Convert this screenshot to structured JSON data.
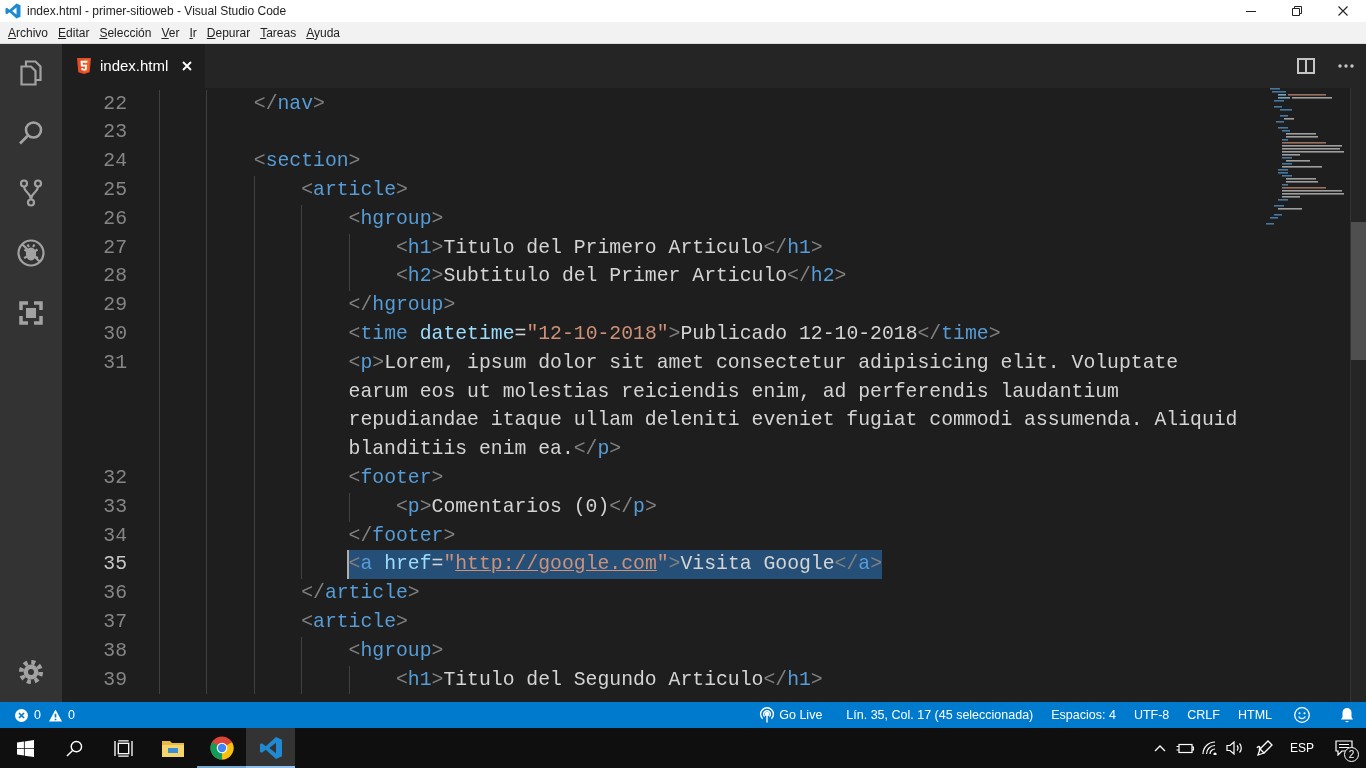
{
  "window": {
    "title": "index.html - primer-sitioweb - Visual Studio Code"
  },
  "menu": [
    "Archivo",
    "Editar",
    "Selección",
    "Ver",
    "Ir",
    "Depurar",
    "Tareas",
    "Ayuda"
  ],
  "activity_bar": [
    {
      "kind": "files",
      "selected": false
    },
    {
      "kind": "search",
      "selected": false
    },
    {
      "kind": "source_control",
      "selected": false
    },
    {
      "kind": "debug",
      "selected": false
    },
    {
      "kind": "extensions",
      "selected": false
    }
  ],
  "tabs": [
    {
      "label": "index.html",
      "selected": true
    }
  ],
  "editor": {
    "lines": [
      {
        "number": "22",
        "selected": false,
        "segments": [
          {
            "tokens": [
              {
                "kind": "punct",
                "text": "</"
              },
              {
                "kind": "tag",
                "text": "nav"
              },
              {
                "kind": "punct",
                "text": ">"
              }
            ]
          }
        ]
      },
      {
        "number": "23",
        "selected": false
      },
      {
        "number": "24",
        "selected": false,
        "segments": [
          {
            "tokens": [
              {
                "kind": "punct",
                "text": "<"
              },
              {
                "kind": "tag",
                "text": "section"
              },
              {
                "kind": "punct",
                "text": ">"
              }
            ]
          }
        ],
        "children": [
          {
            "number": "25",
            "selected": false,
            "segments": [
              {
                "tokens": [
                  {
                    "kind": "punct",
                    "text": "<"
                  },
                  {
                    "kind": "tag",
                    "text": "article"
                  },
                  {
                    "kind": "punct",
                    "text": ">"
                  }
                ]
              }
            ],
            "children": [
              {
                "number": "26",
                "selected": false,
                "segments": [
                  {
                    "tokens": [
                      {
                        "kind": "punct",
                        "text": "<"
                      },
                      {
                        "kind": "tag",
                        "text": "hgroup"
                      },
                      {
                        "kind": "punct",
                        "text": ">"
                      }
                    ]
                  }
                ],
                "children": [
                  {
                    "number": "27",
                    "selected": false,
                    "segments": [
                      {
                        "tokens": [
                          {
                            "kind": "punct",
                            "text": "<"
                          },
                          {
                            "kind": "tag",
                            "text": "h1"
                          },
                          {
                            "kind": "punct",
                            "text": ">"
                          },
                          {
                            "kind": "text",
                            "text": "Titulo del Primero Articulo"
                          },
                          {
                            "kind": "punct",
                            "text": "</"
                          },
                          {
                            "kind": "tag",
                            "text": "h1"
                          },
                          {
                            "kind": "punct",
                            "text": ">"
                          }
                        ]
                      }
                    ]
                  },
                  {
                    "number": "28",
                    "selected": false,
                    "segments": [
                      {
                        "tokens": [
                          {
                            "kind": "punct",
                            "text": "<"
                          },
                          {
                            "kind": "tag",
                            "text": "h2"
                          },
                          {
                            "kind": "punct",
                            "text": ">"
                          },
                          {
                            "kind": "text",
                            "text": "Subtitulo del Primer Articulo"
                          },
                          {
                            "kind": "punct",
                            "text": "</"
                          },
                          {
                            "kind": "tag",
                            "text": "h2"
                          },
                          {
                            "kind": "punct",
                            "text": ">"
                          }
                        ]
                      }
                    ]
                  }
                ]
              },
              {
                "number": "29",
                "selected": false,
                "segments": [
                  {
                    "tokens": [
                      {
                        "kind": "punct",
                        "text": "</"
                      },
                      {
                        "kind": "tag",
                        "text": "hgroup"
                      },
                      {
                        "kind": "punct",
                        "text": ">"
                      }
                    ]
                  }
                ]
              },
              {
                "number": "30",
                "selected": false,
                "segments": [
                  {
                    "tokens": [
                      {
                        "kind": "punct",
                        "text": "<"
                      },
                      {
                        "kind": "tag",
                        "text": "time"
                      },
                      {
                        "kind": "attr",
                        "text": " datetime"
                      },
                      {
                        "kind": "text",
                        "text": "="
                      },
                      {
                        "kind": "string",
                        "text": "\"12-10-2018\""
                      },
                      {
                        "kind": "punct",
                        "text": ">"
                      },
                      {
                        "kind": "text",
                        "text": "Publicado 12-10-2018"
                      },
                      {
                        "kind": "punct",
                        "text": "</"
                      },
                      {
                        "kind": "tag",
                        "text": "time"
                      },
                      {
                        "kind": "punct",
                        "text": ">"
                      }
                    ]
                  }
                ]
              },
              {
                "number": "31",
                "selected": false,
                "segments": [
                  {
                    "tokens": [
                      {
                        "kind": "punct",
                        "text": "<"
                      },
                      {
                        "kind": "tag",
                        "text": "p"
                      },
                      {
                        "kind": "punct",
                        "text": ">"
                      },
                      {
                        "kind": "text",
                        "text": "Lorem, ipsum dolor sit amet consectetur adipisicing elit. Voluptate"
                      }
                    ]
                  },
                  {
                    "tokens": [
                      {
                        "kind": "text",
                        "text": "earum eos ut molestias reiciendis enim, ad perferendis laudantium"
                      }
                    ]
                  },
                  {
                    "tokens": [
                      {
                        "kind": "text",
                        "text": "repudiandae itaque ullam deleniti eveniet fugiat commodi assumenda. Aliquid"
                      }
                    ]
                  },
                  {
                    "tokens": [
                      {
                        "kind": "text",
                        "text": "blanditiis enim ea."
                      },
                      {
                        "kind": "punct",
                        "text": "</"
                      },
                      {
                        "kind": "tag",
                        "text": "p"
                      },
                      {
                        "kind": "punct",
                        "text": ">"
                      }
                    ]
                  }
                ]
              },
              {
                "number": "32",
                "selected": false,
                "segments": [
                  {
                    "tokens": [
                      {
                        "kind": "punct",
                        "text": "<"
                      },
                      {
                        "kind": "tag",
                        "text": "footer"
                      },
                      {
                        "kind": "punct",
                        "text": ">"
                      }
                    ]
                  }
                ],
                "children": [
                  {
                    "number": "33",
                    "selected": false,
                    "segments": [
                      {
                        "tokens": [
                          {
                            "kind": "punct",
                            "text": "<"
                          },
                          {
                            "kind": "tag",
                            "text": "p"
                          },
                          {
                            "kind": "punct",
                            "text": ">"
                          },
                          {
                            "kind": "text",
                            "text": "Comentarios (0)"
                          },
                          {
                            "kind": "punct",
                            "text": "</"
                          },
                          {
                            "kind": "tag",
                            "text": "p"
                          },
                          {
                            "kind": "punct",
                            "text": ">"
                          }
                        ]
                      }
                    ]
                  }
                ]
              },
              {
                "number": "34",
                "selected": false,
                "segments": [
                  {
                    "tokens": [
                      {
                        "kind": "punct",
                        "text": "</"
                      },
                      {
                        "kind": "tag",
                        "text": "footer"
                      },
                      {
                        "kind": "punct",
                        "text": ">"
                      }
                    ]
                  }
                ]
              },
              {
                "number": "35",
                "selected": true,
                "segments": [
                  {
                    "tokens": [
                      {
                        "kind": "punct",
                        "text": "<"
                      },
                      {
                        "kind": "tag",
                        "text": "a"
                      },
                      {
                        "kind": "attr",
                        "text": " href"
                      },
                      {
                        "kind": "text",
                        "text": "="
                      },
                      {
                        "kind": "string",
                        "text": "\""
                      },
                      {
                        "kind": "link",
                        "text": "http://google.com"
                      },
                      {
                        "kind": "string",
                        "text": "\""
                      },
                      {
                        "kind": "punct",
                        "text": ">"
                      },
                      {
                        "kind": "text",
                        "text": "Visita Google"
                      },
                      {
                        "kind": "punct",
                        "text": "</"
                      },
                      {
                        "kind": "tag",
                        "text": "a"
                      },
                      {
                        "kind": "punct",
                        "text": ">"
                      }
                    ]
                  }
                ]
              }
            ]
          },
          {
            "number": "36",
            "selected": false,
            "segments": [
              {
                "tokens": [
                  {
                    "kind": "punct",
                    "text": "</"
                  },
                  {
                    "kind": "tag",
                    "text": "article"
                  },
                  {
                    "kind": "punct",
                    "text": ">"
                  }
                ]
              }
            ]
          },
          {
            "number": "37",
            "selected": false,
            "segments": [
              {
                "tokens": [
                  {
                    "kind": "punct",
                    "text": "<"
                  },
                  {
                    "kind": "tag",
                    "text": "article"
                  },
                  {
                    "kind": "punct",
                    "text": ">"
                  }
                ]
              }
            ],
            "children": [
              {
                "number": "38",
                "selected": false,
                "segments": [
                  {
                    "tokens": [
                      {
                        "kind": "punct",
                        "text": "<"
                      },
                      {
                        "kind": "tag",
                        "text": "hgroup"
                      },
                      {
                        "kind": "punct",
                        "text": ">"
                      }
                    ]
                  }
                ],
                "children": [
                  {
                    "number": "39",
                    "selected": false,
                    "segments": [
                      {
                        "tokens": [
                          {
                            "kind": "punct",
                            "text": "<"
                          },
                          {
                            "kind": "tag",
                            "text": "h1"
                          },
                          {
                            "kind": "punct",
                            "text": ">"
                          },
                          {
                            "kind": "text",
                            "text": "Titulo del Segundo Articulo"
                          },
                          {
                            "kind": "punct",
                            "text": "</"
                          },
                          {
                            "kind": "tag",
                            "text": "h1"
                          },
                          {
                            "kind": "punct",
                            "text": ">"
                          }
                        ]
                      }
                    ]
                  }
                ]
              }
            ]
          }
        ]
      }
    ]
  },
  "status_bar": {
    "problems": [
      {
        "kind": "errors",
        "text": "0"
      },
      {
        "kind": "warnings",
        "text": "0"
      }
    ],
    "items": [
      {
        "kind": "live",
        "text": "Go Live"
      },
      {
        "kind": "plain",
        "text": "Lín. 35, Col. 17 (45 seleccionada)"
      },
      {
        "kind": "plain",
        "text": "Espacios: 4"
      },
      {
        "kind": "plain",
        "text": "UTF-8"
      },
      {
        "kind": "plain",
        "text": "CRLF"
      },
      {
        "kind": "plain",
        "text": "HTML"
      }
    ]
  },
  "taskbar": {
    "apps": [
      {
        "kind": "explorer",
        "running": false,
        "selected": false
      },
      {
        "kind": "browser",
        "running": true,
        "selected": false
      },
      {
        "kind": "editor",
        "running": true,
        "selected": true
      }
    ],
    "language": "ESP",
    "notifications": "2"
  }
}
